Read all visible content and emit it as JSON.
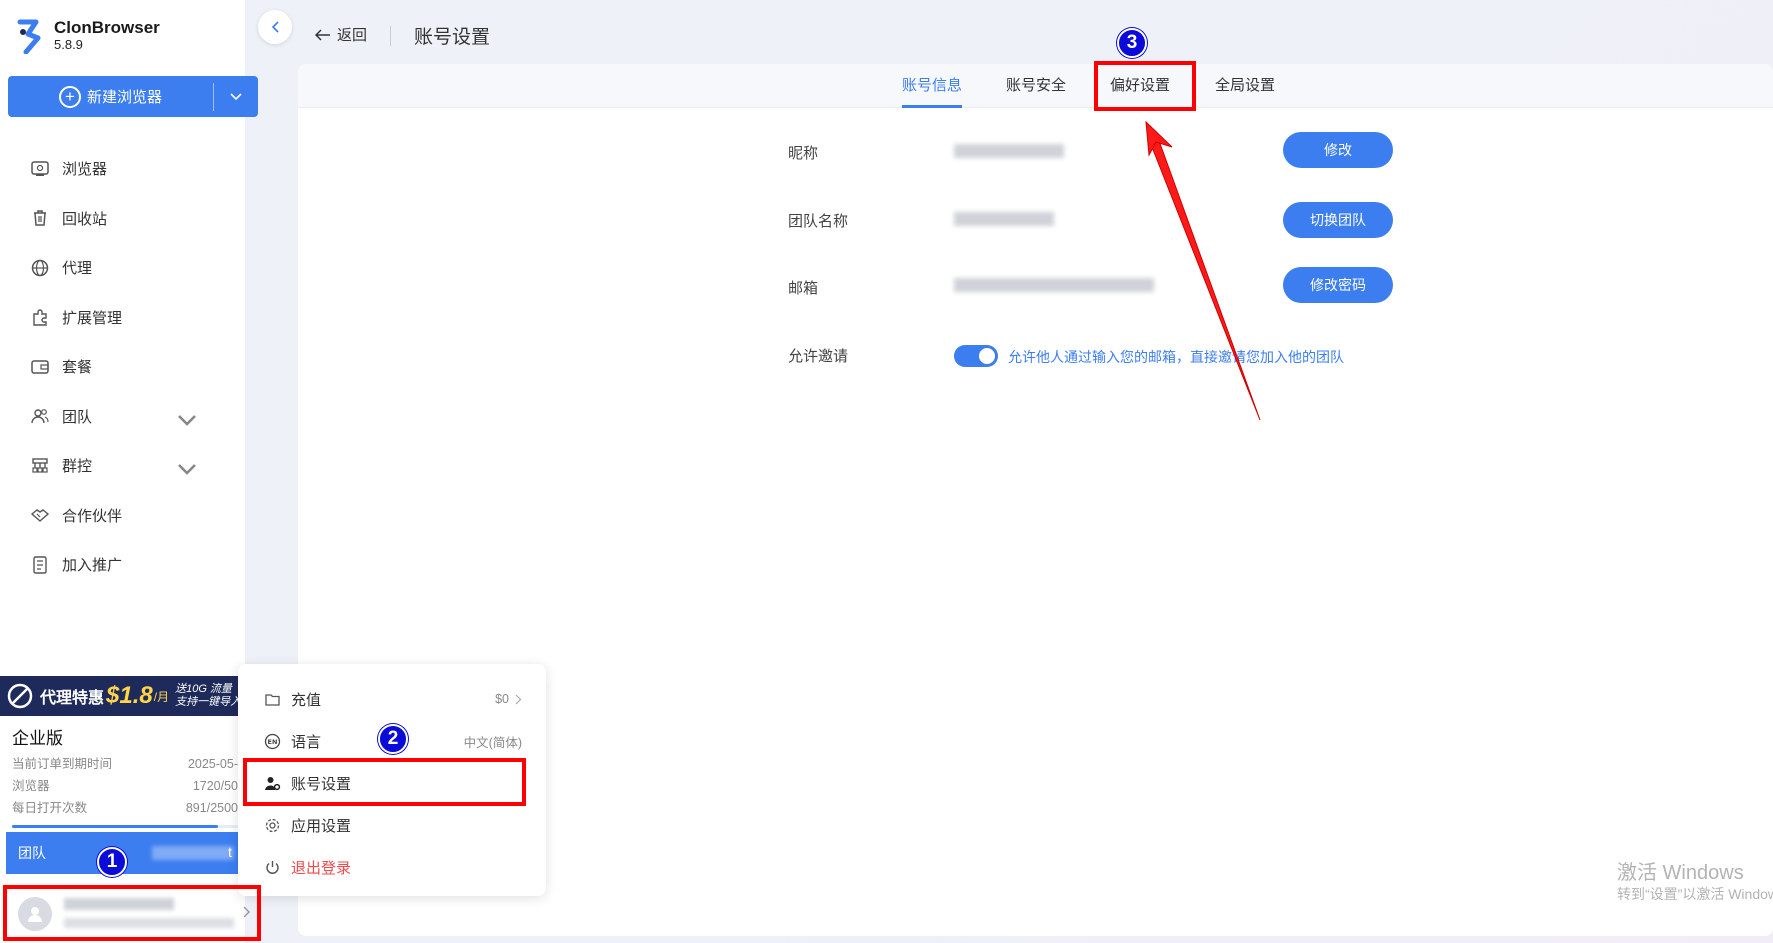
{
  "app": {
    "name": "ClonBrowser",
    "version": "5.8.9"
  },
  "sidebar": {
    "new_browser_label": "新建浏览器",
    "items": [
      {
        "label": "浏览器",
        "icon": "browser-icon"
      },
      {
        "label": "回收站",
        "icon": "trash-icon"
      },
      {
        "label": "代理",
        "icon": "globe-icon"
      },
      {
        "label": "扩展管理",
        "icon": "puzzle-icon"
      },
      {
        "label": "套餐",
        "icon": "wallet-icon"
      },
      {
        "label": "团队",
        "icon": "team-icon",
        "expandable": true
      },
      {
        "label": "群控",
        "icon": "sync-control-icon",
        "expandable": true
      },
      {
        "label": "合作伙伴",
        "icon": "handshake-icon"
      },
      {
        "label": "加入推广",
        "icon": "referral-icon"
      }
    ],
    "promo": {
      "text": "代理特惠",
      "price": "$1.8",
      "unit": "/月",
      "line1": "送10G 流量",
      "line2": "支持一键导入"
    },
    "plan": {
      "title": "企业版",
      "rows": [
        {
          "label": "当前订单到期时间",
          "value": "2025-05-"
        },
        {
          "label": "浏览器",
          "value": "1720/50"
        },
        {
          "label": "每日打开次数",
          "value": "891/2500"
        }
      ],
      "usage_fraction": 0.91
    },
    "team_label": "团队",
    "team_suffix": "t"
  },
  "popup_menu": {
    "items": [
      {
        "label": "充值",
        "value": "$0",
        "icon": "folder-icon"
      },
      {
        "label": "语言",
        "value": "中文(简体)",
        "icon": "language-icon"
      },
      {
        "label": "账号设置",
        "value": "",
        "icon": "user-gear-icon"
      },
      {
        "label": "应用设置",
        "value": "",
        "icon": "gear-icon"
      },
      {
        "label": "退出登录",
        "value": "",
        "icon": "power-icon"
      }
    ]
  },
  "header": {
    "back_label": "返回",
    "title": "账号设置"
  },
  "tabs": [
    {
      "label": "账号信息",
      "active": true
    },
    {
      "label": "账号安全",
      "active": false
    },
    {
      "label": "偏好设置",
      "active": false
    },
    {
      "label": "全局设置",
      "active": false
    }
  ],
  "form": {
    "nickname_label": "昵称",
    "nickname_button": "修改",
    "team_label": "团队名称",
    "team_button": "切换团队",
    "email_label": "邮箱",
    "email_button": "修改密码",
    "invite_label": "允许邀请",
    "invite_enabled": true,
    "invite_text": "允许他人通过输入您的邮箱，直接邀请您加入他的团队"
  },
  "watermark": {
    "line1": "激活 Windows",
    "line2": "转到“设置”以激活 Windows。"
  },
  "annotations": {
    "step1": "1",
    "step2": "2",
    "step3": "3"
  },
  "colors": {
    "accent": "#3c7ef0",
    "annotation_red": "#ff0000",
    "badge_blue": "#0b0bd9",
    "danger": "#f04b4b"
  }
}
